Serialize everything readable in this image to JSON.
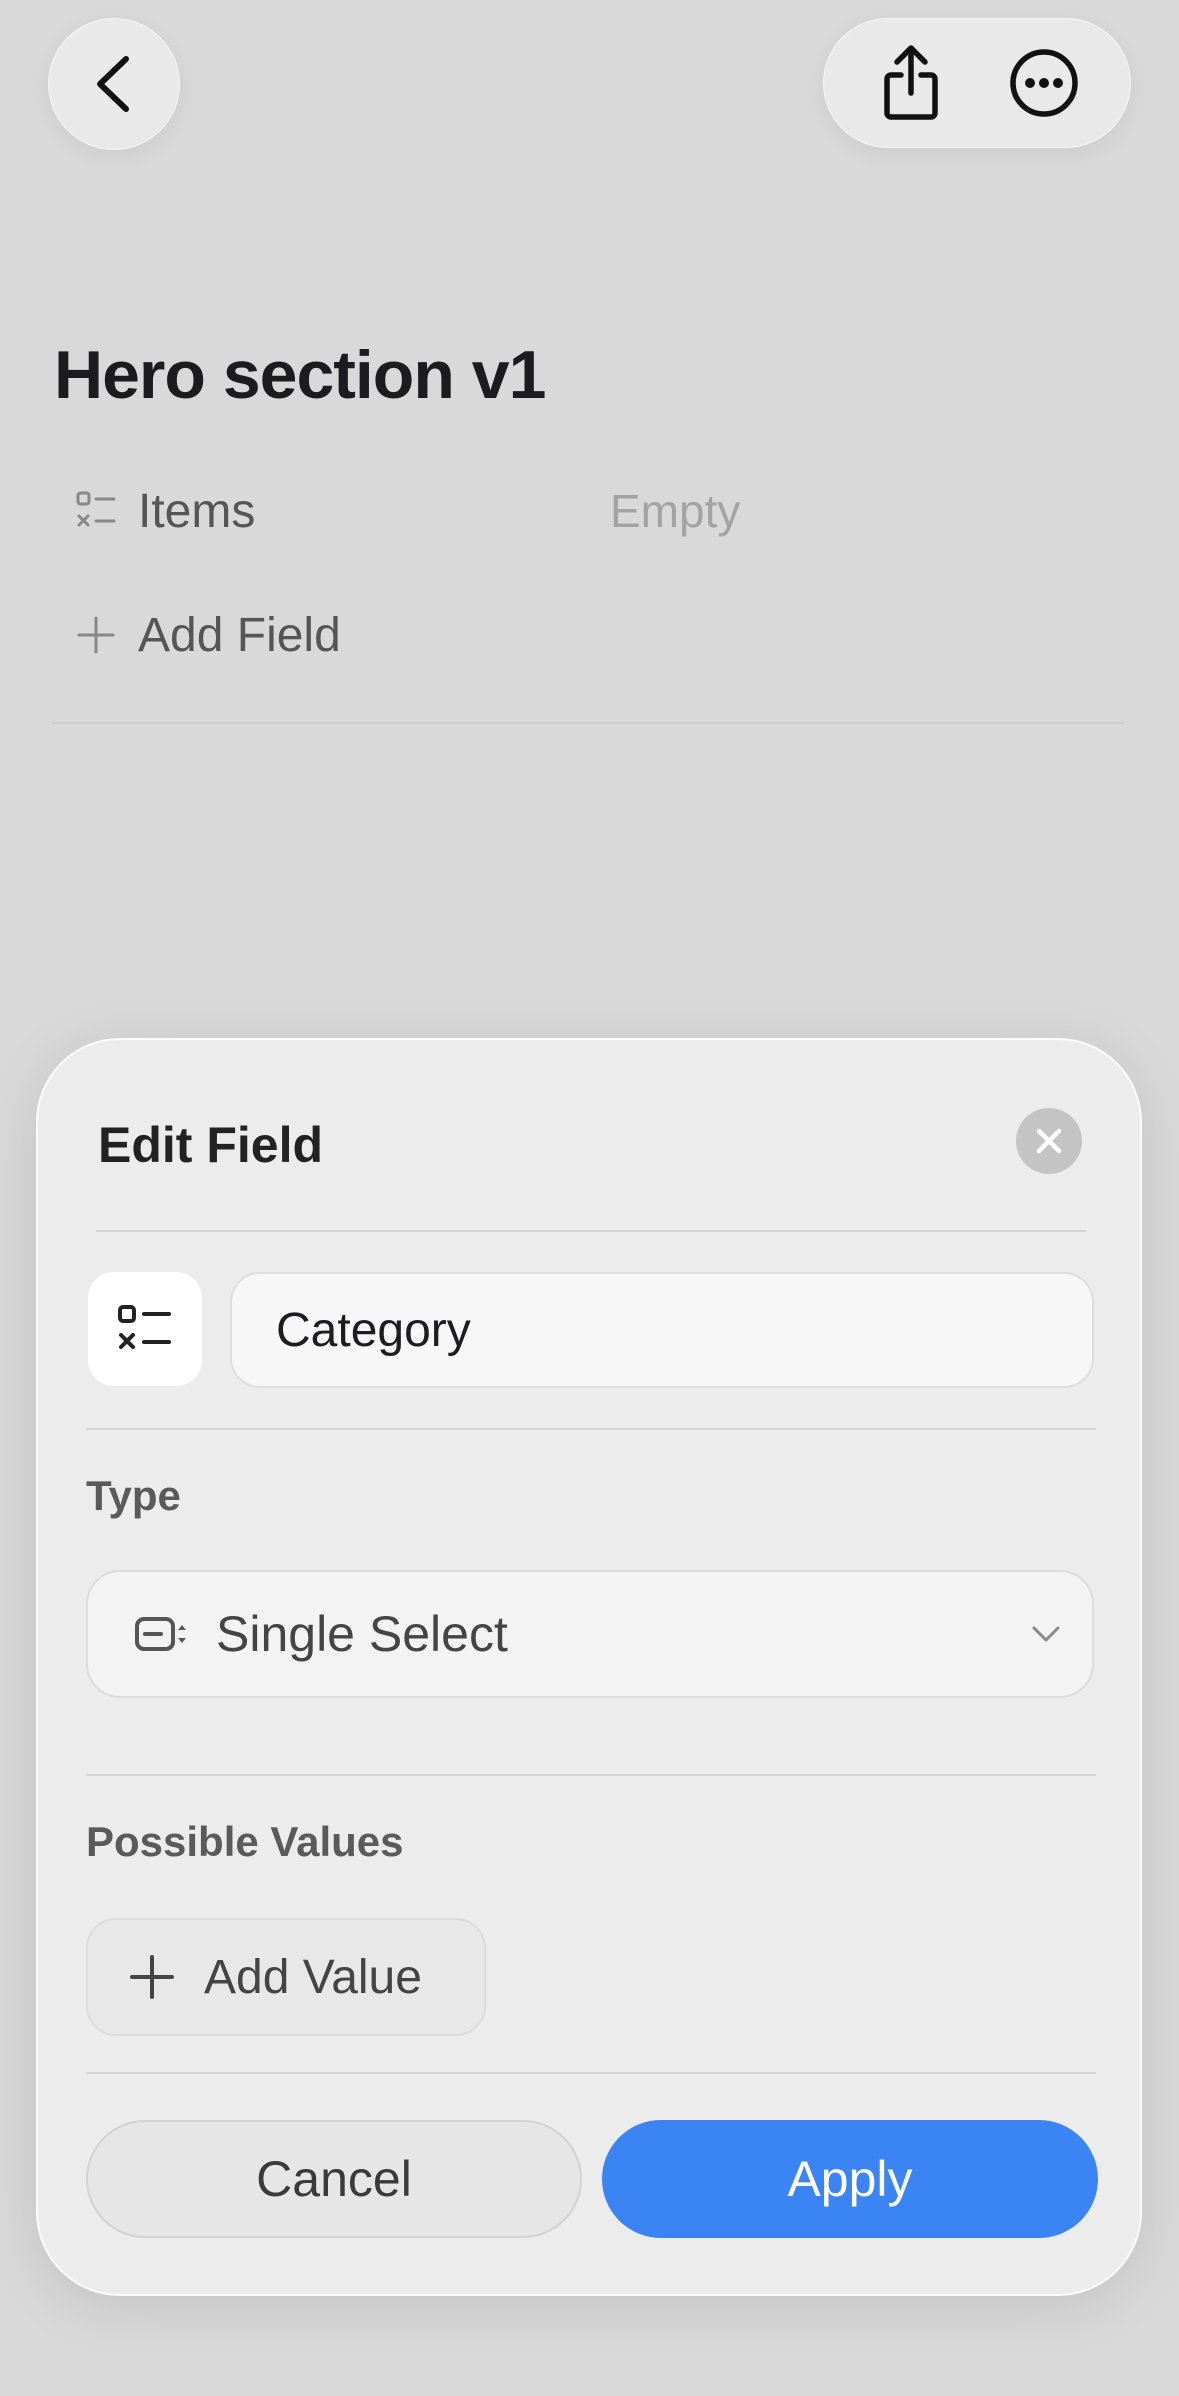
{
  "header": {
    "back_icon": "chevron-left-icon",
    "share_icon": "share-icon",
    "more_icon": "ellipsis-circle-icon"
  },
  "page": {
    "title": "Hero section v1",
    "properties": [
      {
        "icon": "checklist-icon",
        "label": "Items",
        "value": "Empty"
      },
      {
        "icon": "plus-icon",
        "label": "Add Field"
      }
    ]
  },
  "sheet": {
    "title": "Edit Field",
    "close_icon": "close-icon",
    "field_icon": "checklist-icon",
    "field_name": "Category",
    "type_label": "Type",
    "type_value": "Single Select",
    "type_icon": "single-select-icon",
    "possible_values_label": "Possible Values",
    "add_value_label": "Add Value",
    "cancel_label": "Cancel",
    "apply_label": "Apply"
  },
  "colors": {
    "accent": "#3a84f3",
    "background": "#d9d9d9",
    "sheet": "#ececec"
  }
}
